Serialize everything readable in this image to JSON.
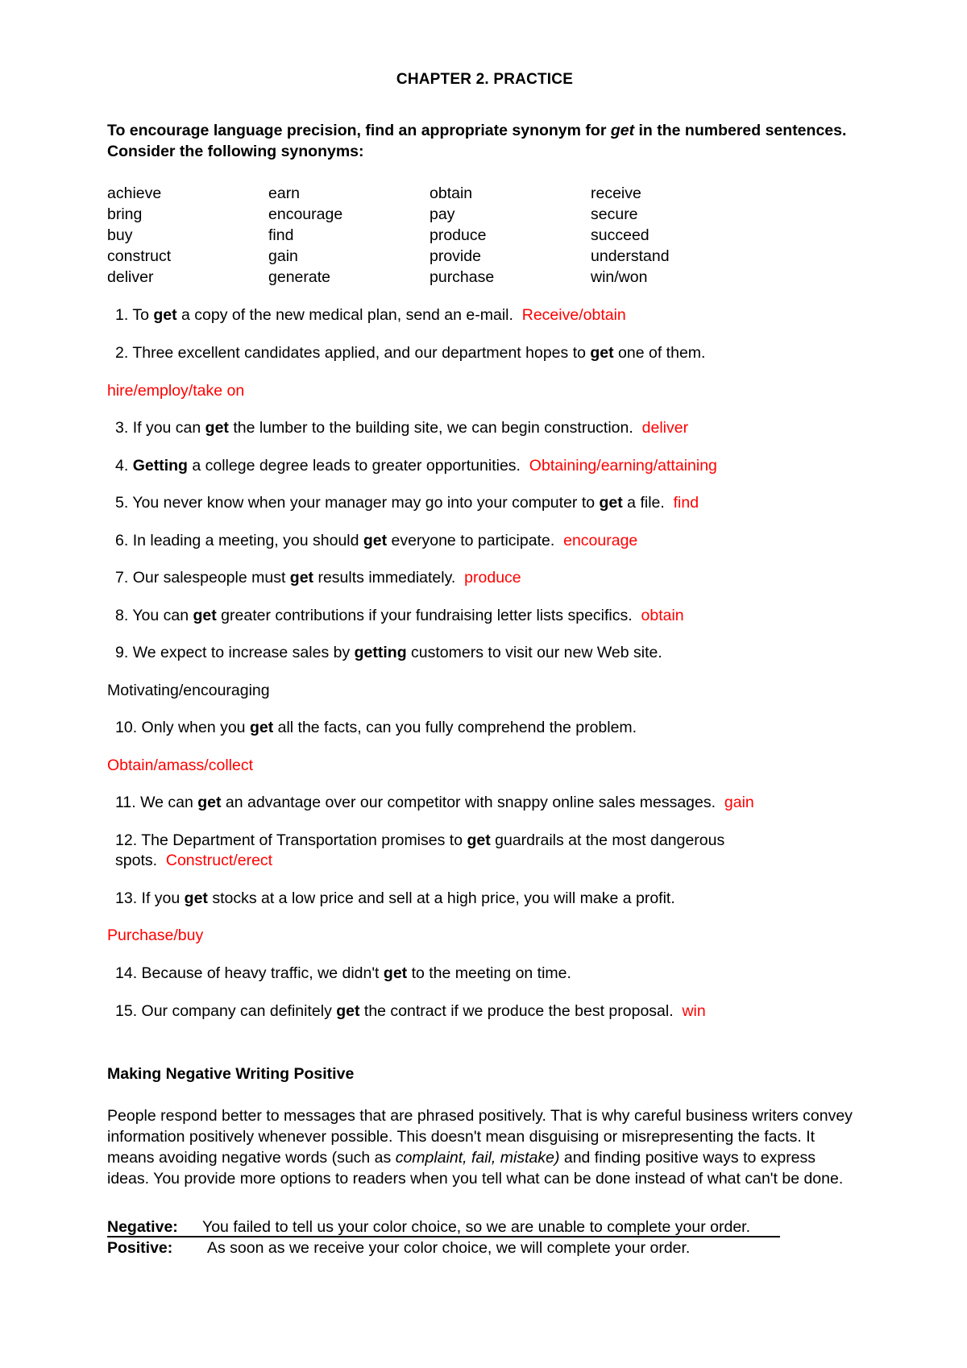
{
  "document": {
    "title": "CHAPTER 2. PRACTICE",
    "instruction_pre": "To encourage language precision, find an appropriate synonym for ",
    "instruction_italic": "get",
    "instruction_post": " in the numbered sentences. Consider the following synonyms",
    "instruction_colon": ":"
  },
  "synonyms": {
    "col1": [
      "achieve",
      "bring",
      "buy",
      "construct",
      "deliver"
    ],
    "col2": [
      "earn",
      "encourage",
      "find",
      "gain",
      "generate"
    ],
    "col3": [
      "obtain",
      "pay",
      "produce",
      "provide",
      "purchase"
    ],
    "col4": [
      "receive",
      "secure",
      "succeed",
      "understand",
      "win/won"
    ]
  },
  "exercises": [
    {
      "number": "1.",
      "pre": "To ",
      "bold": "get",
      "post": " a copy of the new medical plan, send an e-mail.",
      "answer": "Receive/obtain",
      "answer_color": "red",
      "answer_inline": true
    },
    {
      "number": "2.",
      "pre": "Three excellent candidates applied, and our department hopes to ",
      "bold": "get",
      "post": " one of them.",
      "answer": "hire/employ/take on",
      "answer_color": "red",
      "answer_inline": false
    },
    {
      "number": "3.",
      "pre": " If you can ",
      "bold": "get",
      "post": " the lumber to the building site, we can begin construction.",
      "answer": "deliver",
      "answer_color": "red",
      "answer_inline": true
    },
    {
      "number": "4.",
      "pre": "",
      "bold": "Getting",
      "post": " a college degree leads to greater opportunities.",
      "answer": "Obtaining/earning/attaining",
      "answer_color": "red",
      "answer_inline": true
    },
    {
      "number": "5.",
      "pre": "You never know when your manager may go into your computer to ",
      "bold": "get",
      "post": " a file.",
      "answer": "find",
      "answer_color": "red",
      "answer_inline": true
    },
    {
      "number": "6.",
      "pre": "In leading a meeting, you should ",
      "bold": "get",
      "post": " everyone to participate.",
      "answer": "encourage",
      "answer_color": "red",
      "answer_inline": true
    },
    {
      "number": "7.",
      "pre": "Our salespeople must ",
      "bold": "get",
      "post": " results immediately.",
      "answer": "produce",
      "answer_color": "red",
      "answer_inline": true
    },
    {
      "number": "8.",
      "pre": "You can ",
      "bold": "get",
      "post": " greater contributions if your fundraising letter lists specifics.",
      "answer": "obtain",
      "answer_color": "red",
      "answer_inline": true
    },
    {
      "number": "9.",
      "pre": "We expect to increase sales by ",
      "bold": "getting",
      "post": " customers to visit our new Web site.",
      "answer": "Motivating/encouraging",
      "answer_color": "black",
      "answer_inline": false
    },
    {
      "number": "10.",
      "pre": "Only when you ",
      "bold": "get",
      "post": " all the facts, can you fully comprehend the problem.",
      "answer": "Obtain/amass/collect",
      "answer_color": "red",
      "answer_inline": false
    },
    {
      "number": "11.",
      "pre": "We can ",
      "bold": "get",
      "post": " an advantage over our competitor with snappy online sales messages.",
      "answer": "gain",
      "answer_color": "red",
      "answer_inline": true
    },
    {
      "number": "12.",
      "pre": "The Department of Transportation promises to ",
      "bold": "get",
      "post": " guardrails at the most dangerous spots.",
      "answer": "Construct/erect",
      "answer_color": "red",
      "answer_inline": true
    },
    {
      "number": "13.",
      "pre": "If you ",
      "bold": "get",
      "post": " stocks at a low price and sell at a high price, you will make a profit.",
      "answer": "Purchase/buy",
      "answer_color": "red",
      "answer_inline": false
    },
    {
      "number": "14.",
      "pre": "Because of heavy traffic, we didn't ",
      "bold": "get",
      "post": " to the meeting on time.",
      "answer": "",
      "answer_color": "red",
      "answer_inline": true
    },
    {
      "number": "15.",
      "pre": "Our company can definitely ",
      "bold": "get",
      "post": " the contract if we produce the best proposal.",
      "answer": "win",
      "answer_color": "red",
      "answer_inline": true
    }
  ],
  "section2": {
    "heading": "Making Negative Writing Positive",
    "para_part1": "People respond better to messages that are phrased positively. That is why careful business writers convey information positively whenever possible. This doesn't mean disguising or misrepresenting the facts. It means avoiding negative words (such as ",
    "para_italic": "complaint, fail, mistake)",
    "para_part2": " and finding positive ways to express ideas. You provide more options to readers when you tell what can be done instead of what can't be done.",
    "examples": [
      {
        "label": "Negative:",
        "text": "You failed to tell us your color choice, so we are unable to complete your order."
      },
      {
        "label": "Positive:",
        "text": "As soon as we receive your color choice, we will complete your order."
      }
    ]
  },
  "colors": {
    "answer_red": "#ff0000",
    "text_black": "#000000",
    "page_background": "#ffffff"
  }
}
